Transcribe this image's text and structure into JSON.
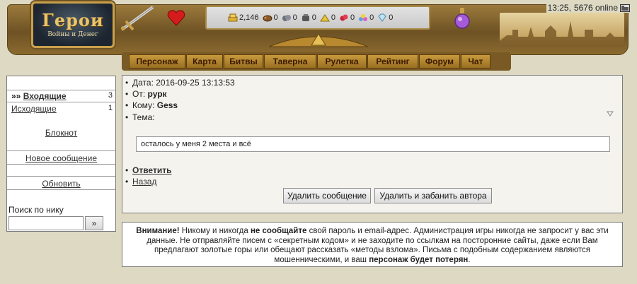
{
  "logo": {
    "title": "Герои",
    "subtitle": "Войны и Денег"
  },
  "status": {
    "time": "13:25,",
    "online": "5676 online"
  },
  "resources": [
    {
      "icon": "gold-icon",
      "value": "2,146"
    },
    {
      "icon": "wood-icon",
      "value": "0"
    },
    {
      "icon": "ore-icon",
      "value": "0"
    },
    {
      "icon": "mercury-icon",
      "value": "0"
    },
    {
      "icon": "sulfur-icon",
      "value": "0"
    },
    {
      "icon": "crystal-icon",
      "value": "0"
    },
    {
      "icon": "gems-icon",
      "value": "0"
    },
    {
      "icon": "diamond-icon",
      "value": "0"
    }
  ],
  "nav": [
    {
      "label": "Персонаж"
    },
    {
      "label": "Карта"
    },
    {
      "label": "Битвы"
    },
    {
      "label": "Таверна"
    },
    {
      "label": "Рулетка"
    },
    {
      "label": "Рейтинг"
    },
    {
      "label": "Форум"
    },
    {
      "label": "Чат"
    }
  ],
  "sidebar": {
    "inbox_label": "Входящие",
    "inbox_prefix": "»»",
    "inbox_count": "3",
    "outbox_label": "Исходящие",
    "outbox_count": "1",
    "notebook_label": "Блокнот",
    "new_message_label": "Новое сообщение",
    "refresh_label": "Обновить",
    "search_label": "Поиск по нику",
    "search_value": "",
    "search_button": "»"
  },
  "message": {
    "date_label": "Дата:",
    "date_value": "2016-09-25 13:13:53",
    "from_label": "От:",
    "from_value": "рурк",
    "to_label": "Кому:",
    "to_value": "Gess",
    "subject_label": "Тема:",
    "subject_value": "",
    "body": "осталось у меня 2 места и всё",
    "reply_label": "Ответить",
    "back_label": "Назад",
    "delete_label": "Удалить сообщение",
    "delete_ban_label": "Удалить и забанить автора"
  },
  "warning": {
    "p1": "Внимание!",
    "p2": " Никому и никогда ",
    "p3": "не сообщайте",
    "p4": " свой пароль и email-адрес. Администрация игры никогда не запросит у вас эти данные. Не отправляйте писем с «секретным кодом» и не заходите по ссылкам на посторонние сайты, даже если Вам предлагают золотые горы или обещают рассказать «методы взлома». Письма с подобным содержанием являются мошенническими, и ваш ",
    "p5": "персонаж будет потерян",
    "p6": "."
  }
}
